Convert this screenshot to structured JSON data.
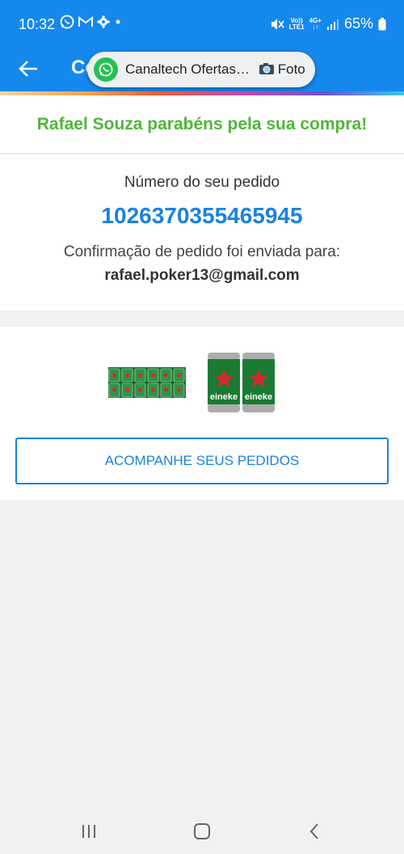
{
  "status_bar": {
    "time": "10:32",
    "battery": "65%",
    "network_top": "Vo))",
    "network_bottom": "LTE1",
    "gen_top": "4G+",
    "gen_bottom": "↓↑"
  },
  "notification": {
    "text": "Canaltech Ofertas… ",
    "suffix": "Foto"
  },
  "header": {
    "title_peek": "Co"
  },
  "congrats": "Rafael Souza parabéns pela sua compra!",
  "order": {
    "label": "Número do seu pedido",
    "number": "1026370355465945",
    "confirmation": "Confirmação de pedido foi enviada para:",
    "email": "rafael.poker13@gmail.com"
  },
  "products": {
    "keg_label": "eineke",
    "track_button": "ACOMPANHE SEUS PEDIDOS"
  },
  "colors": {
    "primary": "#1588ee",
    "accent_blue": "#1a82e0",
    "success_green": "#4fb63b"
  }
}
